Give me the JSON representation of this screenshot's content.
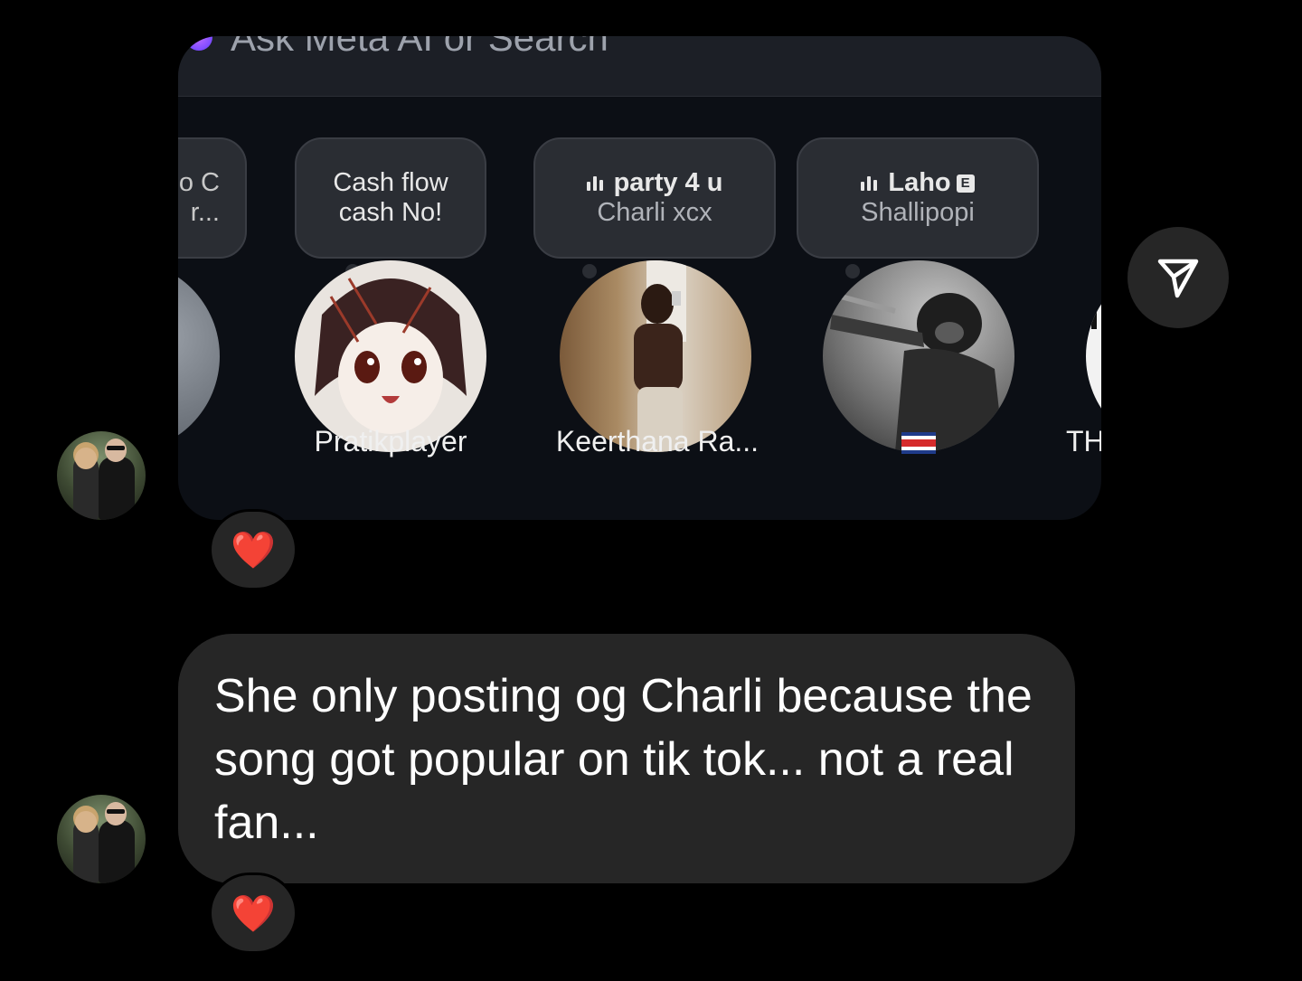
{
  "thread": {
    "message1": {
      "search_placeholder": "Ask Meta AI or Search",
      "notes": [
        {
          "line1": "o C",
          "line2": "r..."
        },
        {
          "line1": "Cash flow",
          "line2": "cash No!"
        },
        {
          "song": "party 4 u",
          "artist": "Charli xcx"
        },
        {
          "song": "Laho",
          "artist": "Shallipopi",
          "explicit": "E"
        }
      ],
      "usernames": [
        "Pratikplayer",
        "Keerthana Ra...",
        "TH"
      ],
      "reaction": "❤️"
    },
    "message2": {
      "text": "She only posting og Charli because the song got popular on tik tok... not a real fan...",
      "reaction": "❤️"
    }
  },
  "colors": {
    "background": "#000000",
    "bubble": "#262626",
    "heart": "#ff2d3c"
  },
  "icons": [
    "avatar",
    "share-send-icon",
    "heart-reaction-icon",
    "music-playing-icon",
    "explicit-icon",
    "costa-rica-flag-icon"
  ]
}
